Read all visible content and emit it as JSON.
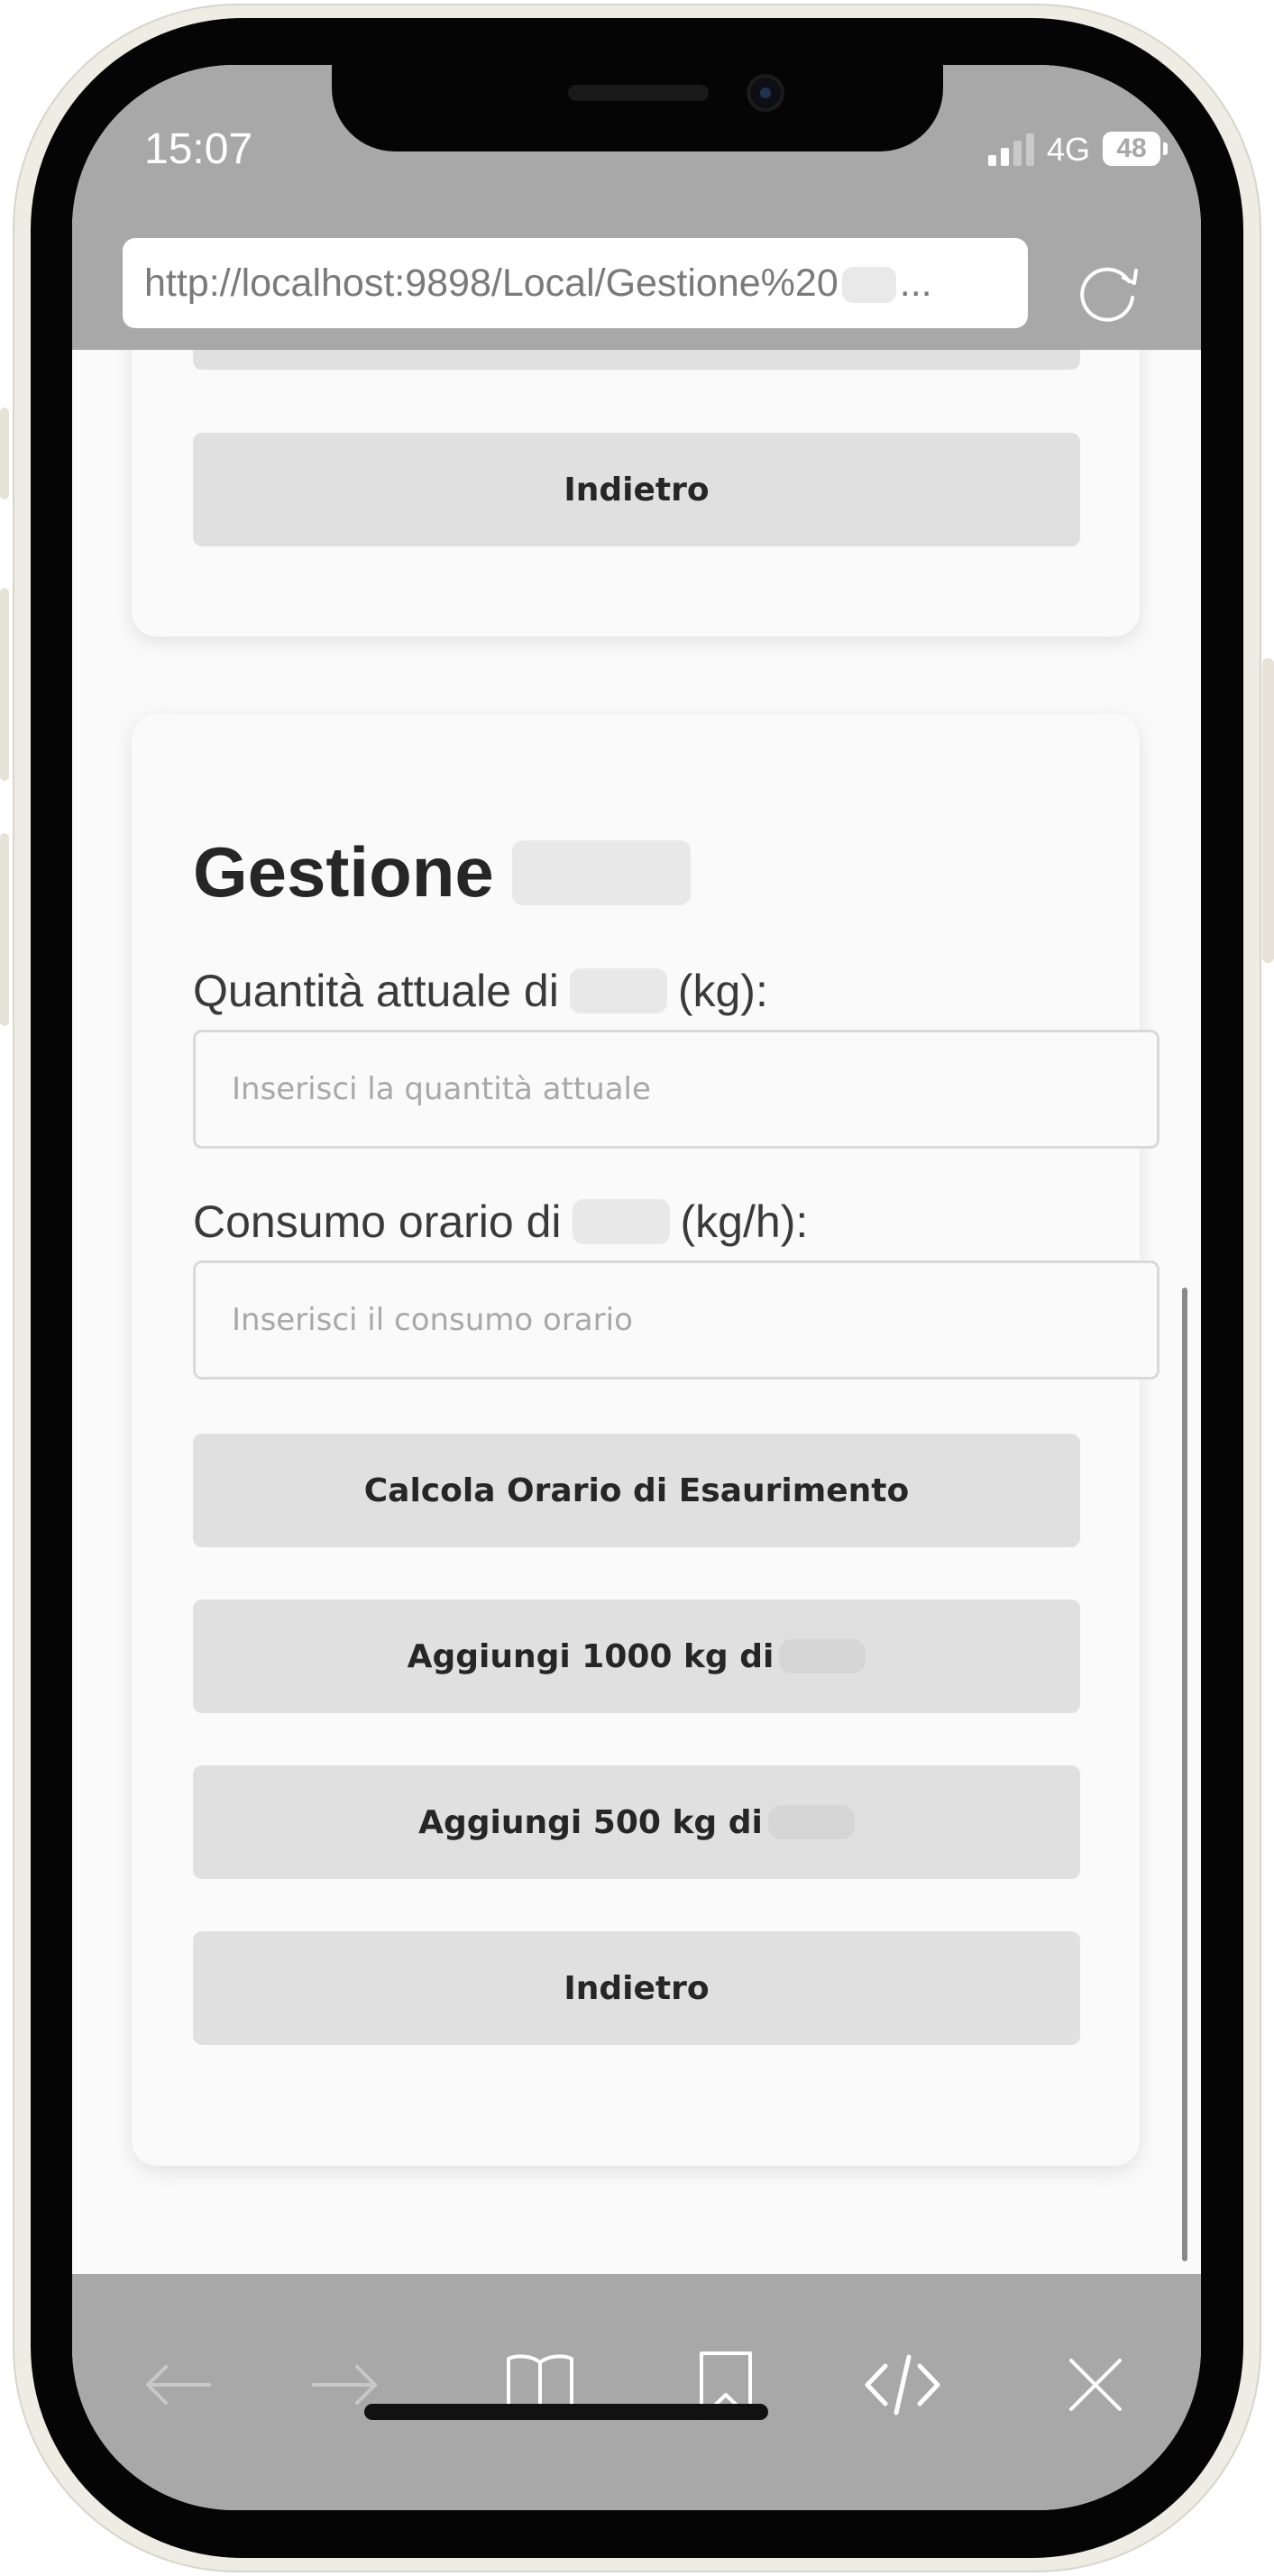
{
  "status_bar": {
    "time": "15:07",
    "network": "4G",
    "battery": "48"
  },
  "browser": {
    "url": "http://localhost:9898/Local/Gestione%20",
    "url_suffix": "..."
  },
  "prev_card": {
    "back_label": "Indietro"
  },
  "form": {
    "title": "Gestione",
    "quantity_label_prefix": "Quantità attuale di",
    "quantity_label_suffix": "(kg):",
    "quantity_placeholder": "Inserisci la quantità attuale",
    "consumption_label_prefix": "Consumo orario di",
    "consumption_label_suffix": "(kg/h):",
    "consumption_placeholder": "Inserisci il consumo orario",
    "calc_label": "Calcola Orario di Esaurimento",
    "add1000_label": "Aggiungi 1000 kg di",
    "add500_label": "Aggiungi 500 kg di",
    "back_label": "Indietro"
  },
  "toolbar": {
    "icons": [
      "back-arrow-icon",
      "forward-arrow-icon",
      "book-icon",
      "bookmark-icon",
      "code-icon",
      "close-icon"
    ]
  },
  "colors": {
    "bar": "#a8a8a8",
    "button": "#e0e0e0",
    "card": "#fafafa"
  }
}
